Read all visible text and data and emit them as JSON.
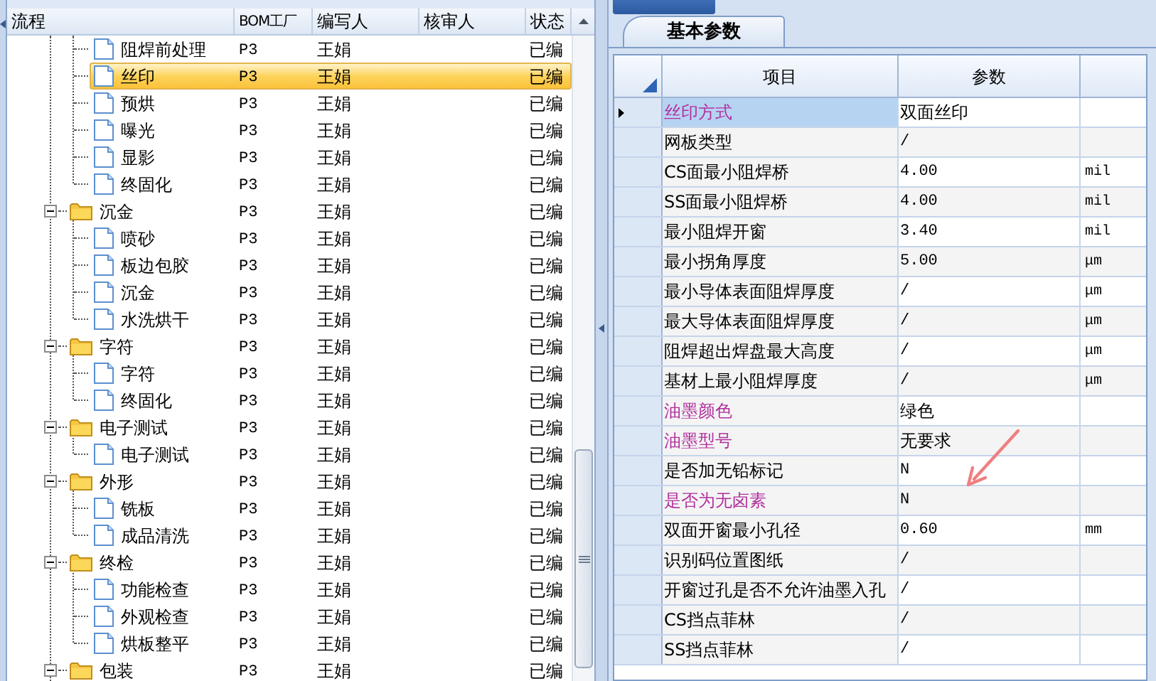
{
  "tree": {
    "columns": [
      "流程",
      "BOM工厂",
      "编写人",
      "核审人",
      "状态"
    ],
    "groups": [
      {
        "children": [
          {
            "label": "阻焊前处理",
            "bom": "P3",
            "writer": "王娟",
            "status": "已编",
            "selected": false
          },
          {
            "label": "丝印",
            "bom": "P3",
            "writer": "王娟",
            "status": "已编",
            "selected": true
          },
          {
            "label": "预烘",
            "bom": "P3",
            "writer": "王娟",
            "status": "已编",
            "selected": false
          },
          {
            "label": "曝光",
            "bom": "P3",
            "writer": "王娟",
            "status": "已编",
            "selected": false
          },
          {
            "label": "显影",
            "bom": "P3",
            "writer": "王娟",
            "status": "已编",
            "selected": false
          },
          {
            "label": "终固化",
            "bom": "P3",
            "writer": "王娟",
            "status": "已编",
            "selected": false
          }
        ]
      },
      {
        "label": "沉金",
        "bom": "P3",
        "writer": "王娟",
        "status": "已编",
        "selected": false,
        "expanded": true,
        "children": [
          {
            "label": "喷砂",
            "bom": "P3",
            "writer": "王娟",
            "status": "已编",
            "selected": false
          },
          {
            "label": "板边包胶",
            "bom": "P3",
            "writer": "王娟",
            "status": "已编",
            "selected": false
          },
          {
            "label": "沉金",
            "bom": "P3",
            "writer": "王娟",
            "status": "已编",
            "selected": false
          },
          {
            "label": "水洗烘干",
            "bom": "P3",
            "writer": "王娟",
            "status": "已编",
            "selected": false
          }
        ]
      },
      {
        "label": "字符",
        "bom": "P3",
        "writer": "王娟",
        "status": "已编",
        "selected": false,
        "expanded": true,
        "children": [
          {
            "label": "字符",
            "bom": "P3",
            "writer": "王娟",
            "status": "已编",
            "selected": false
          },
          {
            "label": "终固化",
            "bom": "P3",
            "writer": "王娟",
            "status": "已编",
            "selected": false
          }
        ]
      },
      {
        "label": "电子测试",
        "bom": "P3",
        "writer": "王娟",
        "status": "已编",
        "selected": false,
        "expanded": true,
        "children": [
          {
            "label": "电子测试",
            "bom": "P3",
            "writer": "王娟",
            "status": "已编",
            "selected": false
          }
        ]
      },
      {
        "label": "外形",
        "bom": "P3",
        "writer": "王娟",
        "status": "已编",
        "selected": false,
        "expanded": true,
        "children": [
          {
            "label": "铣板",
            "bom": "P3",
            "writer": "王娟",
            "status": "已编",
            "selected": false
          },
          {
            "label": "成品清洗",
            "bom": "P3",
            "writer": "王娟",
            "status": "已编",
            "selected": false
          }
        ]
      },
      {
        "label": "终检",
        "bom": "P3",
        "writer": "王娟",
        "status": "已编",
        "selected": false,
        "expanded": true,
        "children": [
          {
            "label": "功能检查",
            "bom": "P3",
            "writer": "王娟",
            "status": "已编",
            "selected": false
          },
          {
            "label": "外观检查",
            "bom": "P3",
            "writer": "王娟",
            "status": "已编",
            "selected": false
          },
          {
            "label": "烘板整平",
            "bom": "P3",
            "writer": "王娟",
            "status": "已编",
            "selected": false
          }
        ]
      },
      {
        "label": "包装",
        "bom": "P3",
        "writer": "王娟",
        "status": "已编",
        "selected": false,
        "expanded": true
      }
    ]
  },
  "params": {
    "tab": "基本参数",
    "columns": [
      "项目",
      "参数"
    ],
    "rows": [
      {
        "item": "丝印方式",
        "value": "双面丝印",
        "required": true,
        "selected": true
      },
      {
        "item": "网板类型",
        "value": "/",
        "required": false,
        "selected": false
      },
      {
        "item": "CS面最小阻焊桥",
        "value": "4.00",
        "unit": "mil",
        "required": false,
        "selected": false
      },
      {
        "item": "SS面最小阻焊桥",
        "value": "4.00",
        "unit": "mil",
        "required": false,
        "selected": false
      },
      {
        "item": "最小阻焊开窗",
        "value": "3.40",
        "unit": "mil",
        "required": false,
        "selected": false
      },
      {
        "item": "最小拐角厚度",
        "value": "5.00",
        "unit": "μm",
        "required": false,
        "selected": false
      },
      {
        "item": "最小导体表面阻焊厚度",
        "value": "/",
        "unit": "μm",
        "required": false,
        "selected": false
      },
      {
        "item": "最大导体表面阻焊厚度",
        "value": "/",
        "unit": "μm",
        "required": false,
        "selected": false
      },
      {
        "item": "阻焊超出焊盘最大高度",
        "value": "/",
        "unit": "μm",
        "required": false,
        "selected": false
      },
      {
        "item": "基材上最小阻焊厚度",
        "value": "/",
        "unit": "μm",
        "required": false,
        "selected": false
      },
      {
        "item": "油墨颜色",
        "value": "绿色",
        "required": true,
        "selected": false
      },
      {
        "item": "油墨型号",
        "value": "无要求",
        "required": true,
        "selected": false
      },
      {
        "item": "是否加无铅标记",
        "value": "N",
        "required": false,
        "selected": false
      },
      {
        "item": "是否为无卤素",
        "value": "N",
        "required": true,
        "selected": false
      },
      {
        "item": "双面开窗最小孔径",
        "value": "0.60",
        "unit": "mm",
        "required": false,
        "selected": false
      },
      {
        "item": "识别码位置图纸",
        "value": "/",
        "required": false,
        "selected": false
      },
      {
        "item": "开窗过孔是否不允许油墨入孔",
        "value": "/",
        "required": false,
        "selected": false
      },
      {
        "item": "CS挡点菲林",
        "value": "/",
        "required": false,
        "selected": false
      },
      {
        "item": "SS挡点菲林",
        "value": "/",
        "required": false,
        "selected": false
      }
    ]
  }
}
